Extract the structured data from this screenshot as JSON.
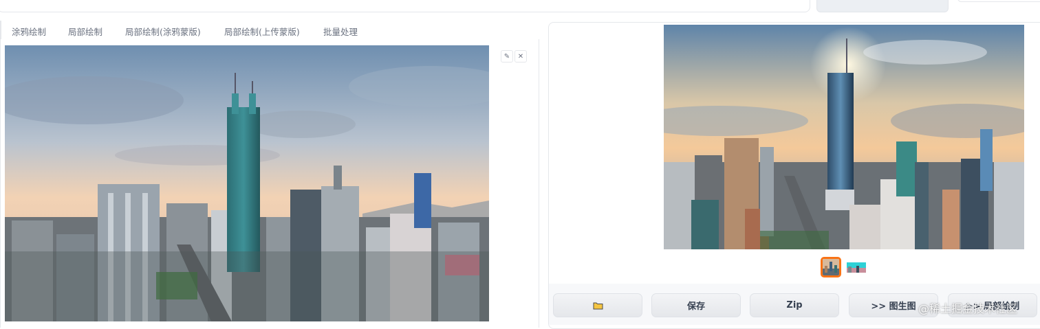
{
  "tabs": [
    {
      "label": "涂鸦绘制"
    },
    {
      "label": "局部绘制"
    },
    {
      "label": "局部绘制(涂鸦蒙版)"
    },
    {
      "label": "局部绘制(上传蒙版)"
    },
    {
      "label": "批量处理"
    }
  ],
  "canvas_tools": {
    "edit_icon": "pencil-icon",
    "close_icon": "close-icon"
  },
  "gallery": {
    "selected_index": 0,
    "thumbnail_count": 2
  },
  "actions": {
    "folder_icon": "folder-icon",
    "save_label": "保存",
    "zip_label": "Zip",
    "img2img_label": ">> 图生图",
    "inpaint_label": ">> 局部绘制"
  },
  "watermark": "@稀土掘金技术社区",
  "colors": {
    "accent": "#f97316",
    "button_bg": "#e5e7eb"
  }
}
